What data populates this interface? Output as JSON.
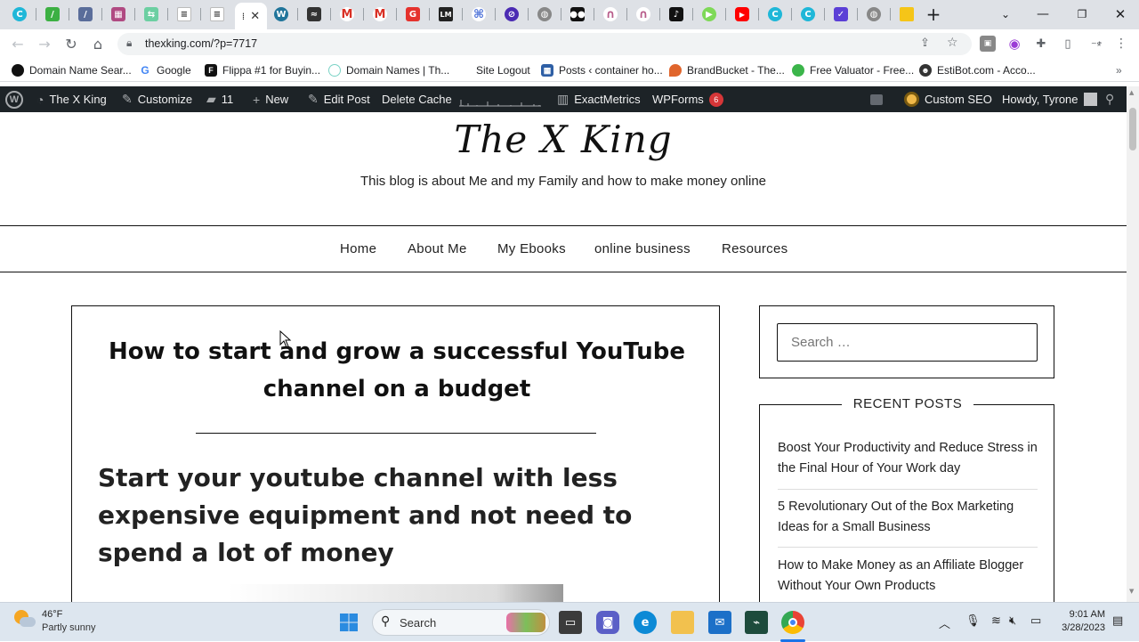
{
  "browser": {
    "url": "thexking.com/?p=7717",
    "bookmarks": [
      {
        "label": "Domain Name Sear...",
        "color": "#111"
      },
      {
        "label": "Google",
        "color": "#4285f4"
      },
      {
        "label": "Flippa #1 for Buyin...",
        "color": "#111"
      },
      {
        "label": "Domain Names | Th...",
        "color": "#7bd3c6"
      },
      {
        "label": "Site Logout",
        "color": ""
      },
      {
        "label": "Posts ‹ container ho...",
        "color": "#2e5fa5"
      },
      {
        "label": "BrandBucket - The...",
        "color": "#e0652c"
      },
      {
        "label": "Free Valuator - Free...",
        "color": "#3bb54a"
      },
      {
        "label": "EstiBot.com - Acco...",
        "color": "#333"
      }
    ]
  },
  "adminbar": {
    "site_name": "The X King",
    "customize": "Customize",
    "comments_count": "11",
    "new": "New",
    "edit_post": "Edit Post",
    "delete_cache": "Delete Cache",
    "exactmetrics": "ExactMetrics",
    "wpforms": "WPForms",
    "wpforms_badge": "6",
    "custom_seo": "Custom SEO",
    "howdy": "Howdy, Tyrone"
  },
  "site": {
    "title": "The X King",
    "description": "This blog is about Me and my Family and how to make money online",
    "nav": [
      "Home",
      "About Me",
      "My Ebooks",
      "online business",
      "Resources"
    ]
  },
  "post": {
    "title": "How to start and grow a successful YouTube channel on a budget",
    "heading": "Start your youtube channel with less expensive equipment and not need to spend a lot of money"
  },
  "sidebar": {
    "search_placeholder": "Search …",
    "recent_title": "RECENT POSTS",
    "recent_posts": [
      "Boost Your Productivity and Reduce Stress in the Final Hour of Your Work day",
      "5 Revolutionary Out of the Box Marketing Ideas for a Small Business",
      "How to Make Money as an Affiliate Blogger Without Your Own Products"
    ]
  },
  "taskbar": {
    "weather_temp": "46°F",
    "weather_desc": "Partly sunny",
    "search_label": "Search",
    "time": "9:01 AM",
    "date": "3/28/2023"
  }
}
